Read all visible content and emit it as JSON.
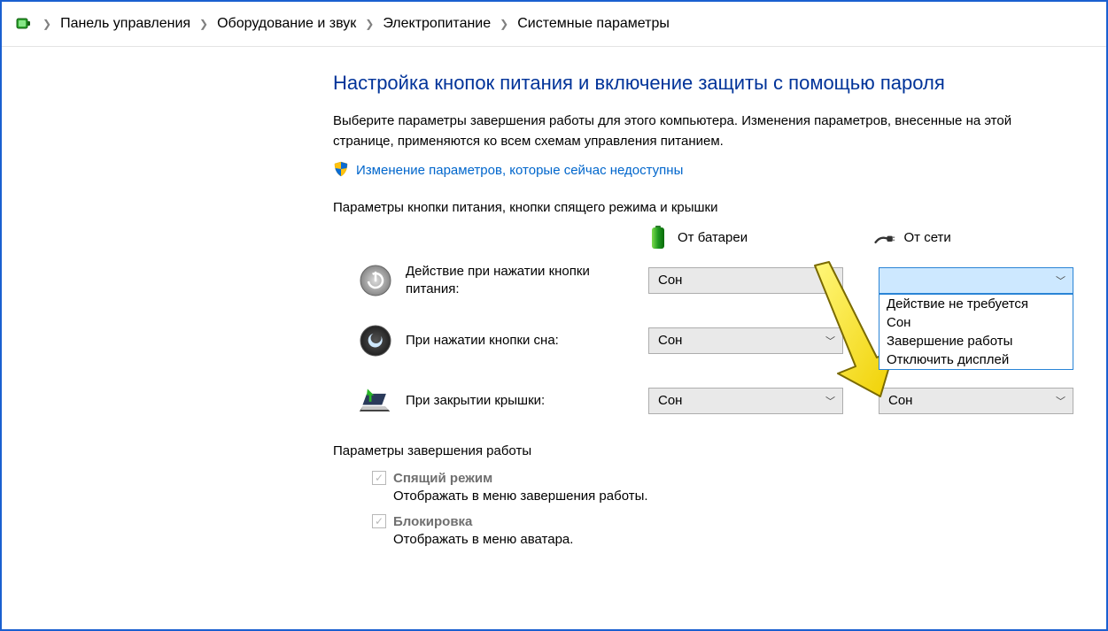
{
  "breadcrumb": {
    "items": [
      "Панель управления",
      "Оборудование и звук",
      "Электропитание",
      "Системные параметры"
    ]
  },
  "title": "Настройка кнопок питания и включение защиты с помощью пароля",
  "description": "Выберите параметры завершения работы для этого компьютера. Изменения параметров, внесенные на этой странице, применяются ко всем схемам управления питанием.",
  "uac_link": "Изменение параметров, которые сейчас недоступны",
  "section1_label": "Параметры кнопки питания, кнопки спящего режима и крышки",
  "columns": {
    "battery": "От батареи",
    "plugged": "От сети"
  },
  "rows": {
    "power": {
      "label": "Действие при нажатии кнопки питания:",
      "battery_value": "Сон",
      "plugged_value": ""
    },
    "sleep": {
      "label": "При нажатии кнопки сна:",
      "battery_value": "Сон",
      "plugged_value": ""
    },
    "lid": {
      "label": "При закрытии крышки:",
      "battery_value": "Сон",
      "plugged_value": "Сон"
    }
  },
  "dropdown_options": [
    "Действие не требуется",
    "Сон",
    "Завершение работы",
    "Отключить дисплей"
  ],
  "section2_label": "Параметры завершения работы",
  "checks": {
    "sleep": {
      "label": "Спящий режим",
      "desc": "Отображать в меню завершения работы."
    },
    "lock": {
      "label": "Блокировка",
      "desc": "Отображать в меню аватара."
    }
  },
  "colors": {
    "link": "#0066cc",
    "title": "#003399",
    "accent_border": "#1a5fd0",
    "arrow": "#ffe600"
  }
}
